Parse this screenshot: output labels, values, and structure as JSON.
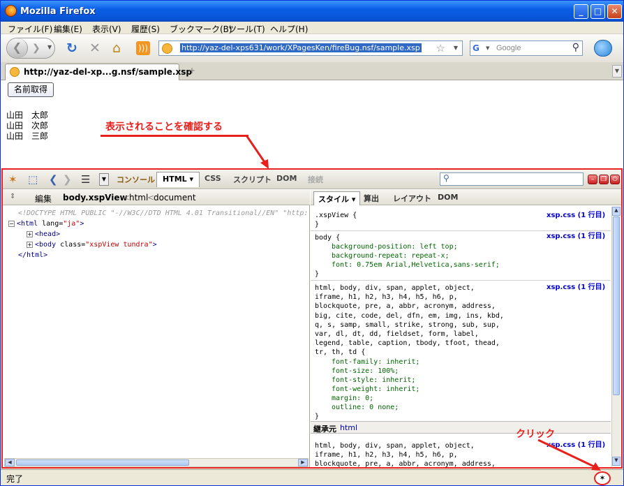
{
  "window": {
    "title": "Mozilla Firefox"
  },
  "menu": [
    "ファイル(F)",
    "編集(E)",
    "表示(V)",
    "履歴(S)",
    "ブックマーク(B)",
    "ツール(T)",
    "ヘルプ(H)"
  ],
  "nav": {
    "url": "http://yaz-del-xps631/work/XPagesKen/fireBug.nsf/sample.xsp",
    "search_placeholder": "Google",
    "search_engine_letter": "G"
  },
  "tabs": [
    {
      "title": "http://yaz-del-xp...g.nsf/sample.xsp"
    }
  ],
  "page": {
    "button_label": "名前取得",
    "names": [
      "山田　太郎",
      "山田　次郎",
      "山田　三郎"
    ],
    "annotation": "表示されることを確認する"
  },
  "firebug": {
    "tabs": [
      "コンソール",
      "HTML ▾",
      "CSS",
      "スクリプト",
      "DOM",
      "接続"
    ],
    "left_subbar": {
      "edit": "編集",
      "crumb_active": "body.xspView",
      "crumb_sep": "<",
      "crumb_html": "html",
      "crumb_document": "document"
    },
    "html_tree": {
      "doctype": "<!DOCTYPE HTML PUBLIC \"-//W3C//DTD HTML 4.01 Transitional//EN\" \"http:",
      "html_open_tag": "<html",
      "html_attr": " lang=",
      "html_attr_val": "\"ja\"",
      "head": "<head>",
      "body_open": "<body",
      "body_attr": " class=",
      "body_attr_val": "\"xspView tundra\"",
      "close_html": "</html>"
    },
    "right_tabs": [
      "スタイル ▾",
      "算出",
      "レイアウト",
      "DOM"
    ],
    "rules": [
      {
        "selector": ".xspView {",
        "source": "xsp.css (1 行目)",
        "props": [],
        "close": "}"
      },
      {
        "selector": "body {",
        "source": "xsp.css (1 行目)",
        "props": [
          "background-position: left top;",
          "background-repeat: repeat-x;",
          "font: 0.75em Arial,Helvetica,sans-serif;"
        ],
        "close": "}"
      },
      {
        "selector": "html, body, div, span, applet, object,\niframe, h1, h2, h3, h4, h5, h6, p,\nblockquote, pre, a, abbr, acronym, address,\nbig, cite, code, del, dfn, em, img, ins, kbd,\nq, s, samp, small, strike, strong, sub, sup,\nvar, dl, dt, dd, fieldset, form, label,\nlegend, table, caption, tbody, tfoot, thead,\ntr, th, td {",
        "source": "xsp.css (1 行目)",
        "props": [
          "font-family: inherit;",
          "font-size: 100%;",
          "font-style: inherit;",
          "font-weight: inherit;",
          "margin: 0;",
          "outline: 0 none;"
        ],
        "close": "}"
      }
    ],
    "inherited_label": "継承元",
    "inherited_from": "html",
    "inherited_rule": {
      "selector": "html, body, div, span, applet, object,\niframe, h1, h2, h3, h4, h5, h6, p,\nblockquote, pre, a, abbr, acronym, address,",
      "source": "xsp.css (1 行目)"
    }
  },
  "status": {
    "text": "完了",
    "annotation": "クリック"
  },
  "colors": {
    "annotation": "#e8201c",
    "titlebar": "#0a5fe6",
    "selection": "#316ac5"
  }
}
